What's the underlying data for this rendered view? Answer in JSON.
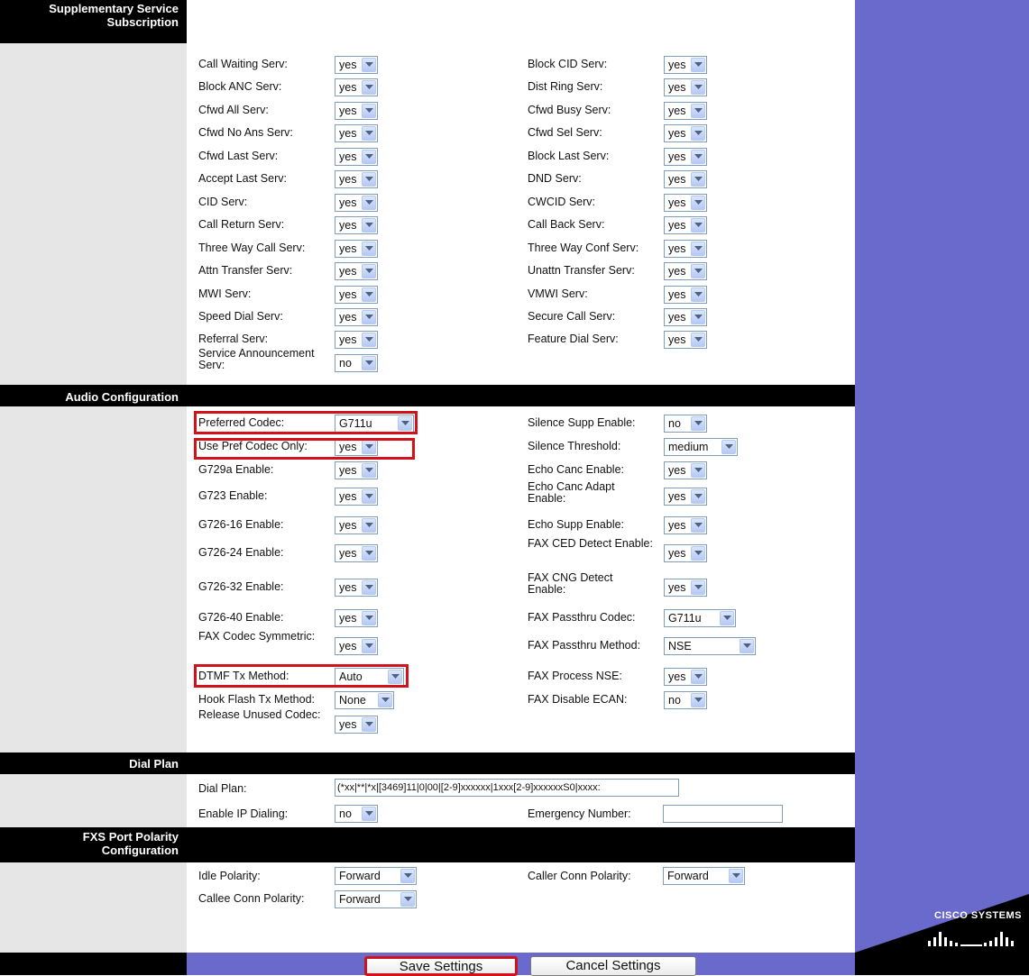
{
  "sections": [
    {
      "id": "supp",
      "title": [
        "Supplementary Service",
        "Subscription"
      ]
    },
    {
      "id": "audio",
      "title": [
        "Audio Configuration"
      ]
    },
    {
      "id": "dial",
      "title": [
        "Dial Plan"
      ]
    },
    {
      "id": "fxs",
      "title": [
        "FXS Port Polarity",
        "Configuration"
      ]
    }
  ],
  "supplementary": {
    "left": [
      {
        "label": "Call Waiting Serv:",
        "value": "yes"
      },
      {
        "label": "Block ANC Serv:",
        "value": "yes"
      },
      {
        "label": "Cfwd All Serv:",
        "value": "yes"
      },
      {
        "label": "Cfwd No Ans Serv:",
        "value": "yes"
      },
      {
        "label": "Cfwd Last Serv:",
        "value": "yes"
      },
      {
        "label": "Accept Last Serv:",
        "value": "yes"
      },
      {
        "label": "CID Serv:",
        "value": "yes"
      },
      {
        "label": "Call Return Serv:",
        "value": "yes"
      },
      {
        "label": "Three Way Call Serv:",
        "value": "yes"
      },
      {
        "label": "Attn Transfer Serv:",
        "value": "yes"
      },
      {
        "label": "MWI Serv:",
        "value": "yes"
      },
      {
        "label": "Speed Dial Serv:",
        "value": "yes"
      },
      {
        "label": "Referral Serv:",
        "value": "yes"
      },
      {
        "label": "Service Announcement Serv:",
        "value": "no"
      }
    ],
    "right": [
      {
        "label": "Block CID Serv:",
        "value": "yes"
      },
      {
        "label": "Dist Ring Serv:",
        "value": "yes"
      },
      {
        "label": "Cfwd Busy Serv:",
        "value": "yes"
      },
      {
        "label": "Cfwd Sel Serv:",
        "value": "yes"
      },
      {
        "label": "Block Last Serv:",
        "value": "yes"
      },
      {
        "label": "DND Serv:",
        "value": "yes"
      },
      {
        "label": "CWCID Serv:",
        "value": "yes"
      },
      {
        "label": "Call Back Serv:",
        "value": "yes"
      },
      {
        "label": "Three Way Conf Serv:",
        "value": "yes"
      },
      {
        "label": "Unattn Transfer Serv:",
        "value": "yes"
      },
      {
        "label": "VMWI Serv:",
        "value": "yes"
      },
      {
        "label": "Secure Call Serv:",
        "value": "yes"
      },
      {
        "label": "Feature Dial Serv:",
        "value": "yes"
      }
    ]
  },
  "audio": {
    "left": [
      {
        "label": "Preferred Codec:",
        "value": "G711u"
      },
      {
        "label": "Use Pref Codec Only:",
        "value": "yes"
      },
      {
        "label": "G729a Enable:",
        "value": "yes"
      },
      {
        "label": "G723 Enable:",
        "value": "yes"
      },
      {
        "label": "G726-16 Enable:",
        "value": "yes"
      },
      {
        "label": "G726-24 Enable:",
        "value": "yes"
      },
      {
        "label": "G726-32 Enable:",
        "value": "yes"
      },
      {
        "label": "G726-40 Enable:",
        "value": "yes"
      },
      {
        "label": "FAX Codec Symmetric:",
        "value": "yes"
      },
      {
        "label": "DTMF Tx Method:",
        "value": "Auto"
      },
      {
        "label": "Hook Flash Tx Method:",
        "value": "None"
      },
      {
        "label": "Release Unused Codec:",
        "value": "yes"
      }
    ],
    "right": [
      {
        "label": "Silence Supp Enable:",
        "value": "no"
      },
      {
        "label": "Silence Threshold:",
        "value": "medium"
      },
      {
        "label": "Echo Canc Enable:",
        "value": "yes"
      },
      {
        "label": "Echo Canc Adapt Enable:",
        "value": "yes"
      },
      {
        "label": "Echo Supp Enable:",
        "value": "yes"
      },
      {
        "label": "FAX CED Detect Enable:",
        "value": "yes"
      },
      {
        "label": "FAX CNG Detect Enable:",
        "value": "yes"
      },
      {
        "label": "FAX Passthru Codec:",
        "value": "G711u"
      },
      {
        "label": "FAX Passthru Method:",
        "value": "NSE"
      },
      {
        "label": "FAX Process NSE:",
        "value": "yes"
      },
      {
        "label": "FAX Disable ECAN:",
        "value": "no"
      }
    ]
  },
  "dialplan": {
    "dial_plan_label": "Dial Plan:",
    "dial_plan_value": "(*xx|**|*x|[3469]11|0|00|[2-9]xxxxxx|1xxx[2-9]xxxxxxS0|xxxx:",
    "enable_ip_label": "Enable IP Dialing:",
    "enable_ip_value": "no",
    "emergency_label": "Emergency Number:",
    "emergency_value": ""
  },
  "fxs": {
    "idle_label": "Idle Polarity:",
    "idle_value": "Forward",
    "caller_label": "Caller Conn Polarity:",
    "caller_value": "Forward",
    "callee_label": "Callee Conn Polarity:",
    "callee_value": "Forward"
  },
  "buttons": {
    "save": "Save Settings",
    "cancel": "Cancel Settings"
  },
  "logo_text": "Cisco Systems",
  "colors": {
    "sidebar_purple": "#6a6acd",
    "highlight_red": "#d3111b",
    "header_black": "#000000"
  }
}
